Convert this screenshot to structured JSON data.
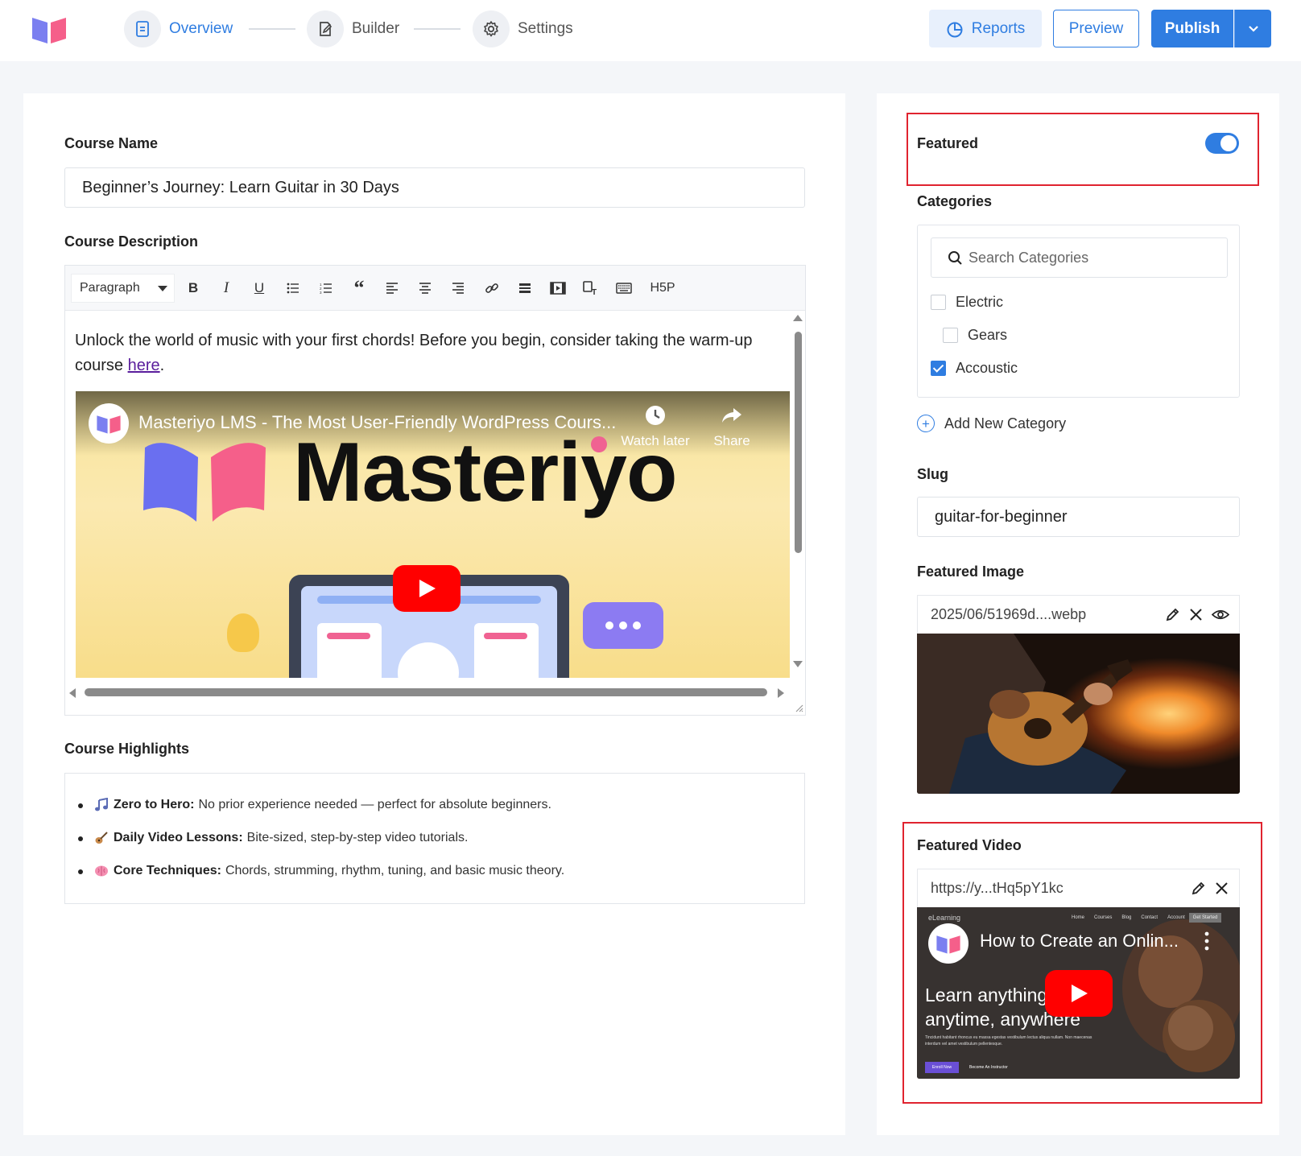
{
  "header": {
    "steps": [
      {
        "label": "Overview",
        "icon": "document-icon",
        "active": true
      },
      {
        "label": "Builder",
        "icon": "edit-icon",
        "active": false
      },
      {
        "label": "Settings",
        "icon": "gear-icon",
        "active": false
      }
    ],
    "reports_label": "Reports",
    "preview_label": "Preview",
    "publish_label": "Publish"
  },
  "course": {
    "name_label": "Course Name",
    "name_value": "Beginner’s Journey: Learn Guitar in 30 Days",
    "description_label": "Course Description",
    "toolbar": {
      "paragraph_select": "Paragraph",
      "h5p_label": "H5P"
    },
    "description_text_before": "Unlock the world of music with your first chords! Before you begin, consider taking the warm-up course ",
    "description_link": "here",
    "description_text_after": ".",
    "embedded_video": {
      "title": "Masteriyo LMS - The Most User-Friendly WordPress Cours...",
      "watch_later": "Watch later",
      "share": "Share",
      "brand": "Masteriyo"
    },
    "highlights_label": "Course Highlights",
    "highlights": [
      {
        "title": "Zero to Hero:",
        "text": "No prior experience needed — perfect for absolute beginners."
      },
      {
        "title": "Daily Video Lessons:",
        "text": "Bite-sized, step-by-step video tutorials."
      },
      {
        "title": "Core Techniques:",
        "text": "Chords, strumming, rhythm, tuning, and basic music theory."
      }
    ]
  },
  "sidebar": {
    "featured_label": "Featured",
    "featured_on": true,
    "categories_label": "Categories",
    "search_placeholder": "Search Categories",
    "categories": [
      {
        "label": "Electric",
        "checked": false
      },
      {
        "label": "Gears",
        "checked": false
      },
      {
        "label": "Accoustic",
        "checked": true
      }
    ],
    "add_category_label": "Add New Category",
    "slug_label": "Slug",
    "slug_value": "guitar-for-beginner",
    "featured_image_label": "Featured Image",
    "featured_image_file": "2025/06/51969d....webp",
    "featured_video_label": "Featured Video",
    "featured_video_url": "https://y...tHq5pY1kc",
    "featured_video": {
      "title": "How to Create an Onlin...",
      "overlay_line1": "Learn anything",
      "overlay_line2": "anytime, anywhere",
      "site_logo": "eLearning",
      "nav_items": [
        "Home",
        "Courses",
        "Blog",
        "Contact",
        "Account"
      ],
      "nav_cta": "Get Started",
      "fine_print": "Tincidunt habitant rhoncus eu massa egestas vestibulum lectus aliqua nullam. Non maecenas interdum vel amet vestibulum pellentesque.",
      "enroll": "Enroll Now",
      "become": "Become An Instructor"
    }
  },
  "colors": {
    "accent": "#2f7de1",
    "highlight_border": "#e0232f",
    "youtube_red": "#ff0000"
  }
}
